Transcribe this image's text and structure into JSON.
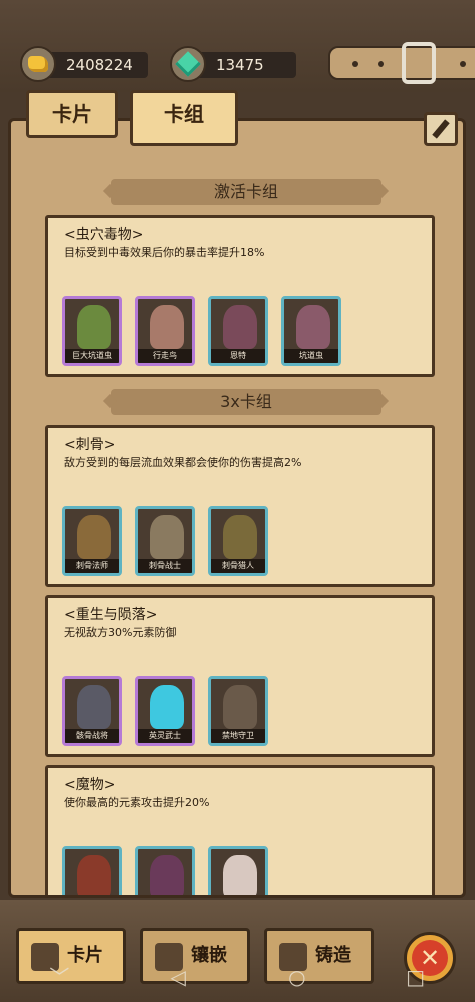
{
  "resources": {
    "gold": "2408224",
    "gems": "13475"
  },
  "tabs": [
    {
      "label": "卡片"
    },
    {
      "label": "卡组"
    }
  ],
  "sections": [
    {
      "title": "激活卡组"
    },
    {
      "title": "3x卡组"
    }
  ],
  "groups": [
    {
      "name": "<虫穴毒物>",
      "desc": "目标受到中毒效果后你的暴击率提升18%",
      "cards": [
        {
          "name": "巨大坑道虫",
          "rarity": "purple",
          "color": "#6b8a3e"
        },
        {
          "name": "行走鸟",
          "rarity": "purple",
          "color": "#a87a6a"
        },
        {
          "name": "恩特",
          "rarity": "blue",
          "color": "#7a4a5a"
        },
        {
          "name": "坑道虫",
          "rarity": "blue",
          "color": "#8a5a6a"
        }
      ]
    },
    {
      "name": "<刺骨>",
      "desc": "敌方受到的每层流血效果都会使你的伤害提高2%",
      "cards": [
        {
          "name": "刺骨法师",
          "rarity": "blue",
          "color": "#8a6a3a"
        },
        {
          "name": "刺骨战士",
          "rarity": "blue",
          "color": "#8a7a60"
        },
        {
          "name": "刺骨猎人",
          "rarity": "blue",
          "color": "#7a6a3a"
        }
      ]
    },
    {
      "name": "<重生与陨落>",
      "desc": "无视敌方30%元素防御",
      "cards": [
        {
          "name": "骸骨战将",
          "rarity": "purple",
          "color": "#5a5a66"
        },
        {
          "name": "英灵武士",
          "rarity": "purple",
          "color": "#3ec8e0"
        },
        {
          "name": "禁地守卫",
          "rarity": "blue",
          "color": "#6a5a4a"
        }
      ]
    },
    {
      "name": "<魔物>",
      "desc": "使你最高的元素攻击提升20%",
      "cards": [
        {
          "name": "",
          "rarity": "blue",
          "color": "#8a3a2a"
        },
        {
          "name": "",
          "rarity": "blue",
          "color": "#6a3a5a"
        },
        {
          "name": "",
          "rarity": "blue",
          "color": "#d8c8c0"
        }
      ]
    }
  ],
  "bottom_tabs": [
    {
      "label": "卡片"
    },
    {
      "label": "镶嵌"
    },
    {
      "label": "铸造"
    }
  ],
  "close_label": "✕",
  "nav": {
    "back": "◁",
    "home": "○",
    "recent": "□",
    "down": "﹀"
  }
}
